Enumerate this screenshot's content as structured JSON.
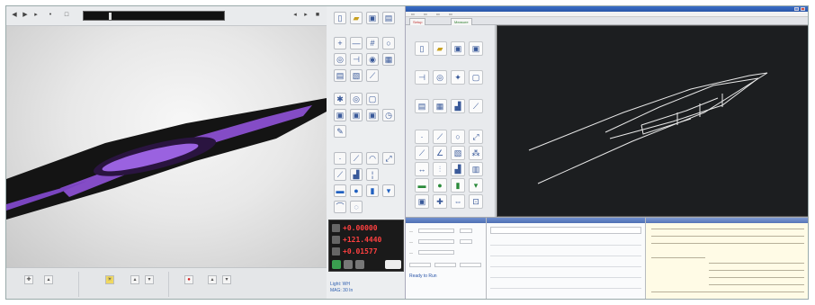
{
  "video": {
    "toolbar_icons": [
      "step-back-icon",
      "play-icon",
      "step-forward-icon",
      "record-icon",
      "snapshot-icon"
    ],
    "right_icons": [
      "previous-icon",
      "next-icon",
      "stop-icon"
    ],
    "seek_text": ""
  },
  "readout": {
    "x": "+0.00000",
    "y": "+121.4440",
    "z": "+0.01577",
    "color": "#ff4040"
  },
  "tools_footer": {
    "light": "Light: WH",
    "mode": "MAG: 30 In"
  },
  "app": {
    "tabs": [
      "Setup",
      "Measure"
    ],
    "status": "Ready to Run"
  },
  "colors": {
    "needle_purple": "#8a4fd0",
    "cad_bg": "#1c1e20",
    "accent_blue": "#2a56a8"
  }
}
